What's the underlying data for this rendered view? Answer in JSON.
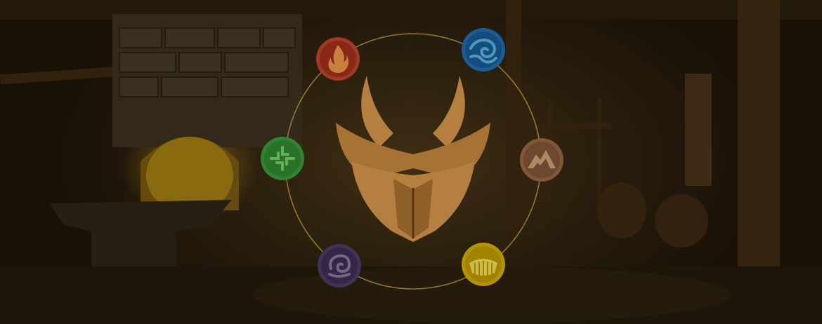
{
  "scene": {
    "description_name": "element-selection-screen"
  },
  "elements": [
    {
      "name": "fire",
      "icon": "fire-icon",
      "ring_color": "#c0462e",
      "fill": "#a7301d",
      "glyph_color": "#f39a4c"
    },
    {
      "name": "water",
      "icon": "water-icon",
      "ring_color": "#1f6fb7",
      "fill": "#165c9c",
      "glyph_color": "#5fb6e6"
    },
    {
      "name": "earth",
      "icon": "earth-icon",
      "ring_color": "#9b6a43",
      "fill": "#83573a",
      "glyph_color": "#d6a57a"
    },
    {
      "name": "light",
      "icon": "light-icon",
      "ring_color": "#d8b400",
      "fill": "#c49f00",
      "glyph_color": "#f7e25b"
    },
    {
      "name": "death",
      "icon": "death-icon",
      "ring_color": "#4d3c6a",
      "fill": "#3c2e57",
      "glyph_color": "#8b7aa8"
    },
    {
      "name": "life",
      "icon": "life-icon",
      "ring_color": "#3b9e3d",
      "fill": "#2f8a32",
      "glyph_color": "#7fd36a"
    }
  ],
  "colors": {
    "circle_line": "#c9a640",
    "emblem": "#d99a4d",
    "emblem_shadow": "#8a5520"
  }
}
